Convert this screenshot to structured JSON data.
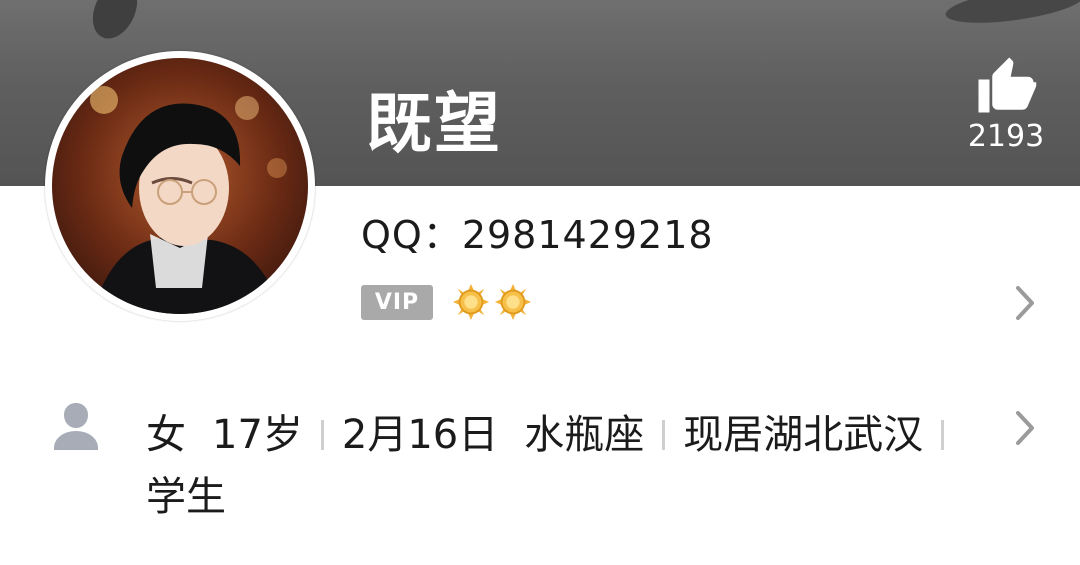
{
  "profile": {
    "nickname": "既望",
    "qq_label": "QQ：2981429218",
    "vip_label": "VIP",
    "like_count": "2193",
    "level_icons": [
      "sun-icon",
      "sun-icon"
    ]
  },
  "details": {
    "gender": "女",
    "age": "17岁",
    "birthday": "2月16日",
    "zodiac": "水瓶座",
    "location": "现居湖北武汉",
    "occupation": "学生"
  },
  "colors": {
    "banner": "#5f5f5f",
    "text": "#1b1b1b",
    "chevron": "#9b9b9b",
    "sun": "#f3b23a"
  }
}
